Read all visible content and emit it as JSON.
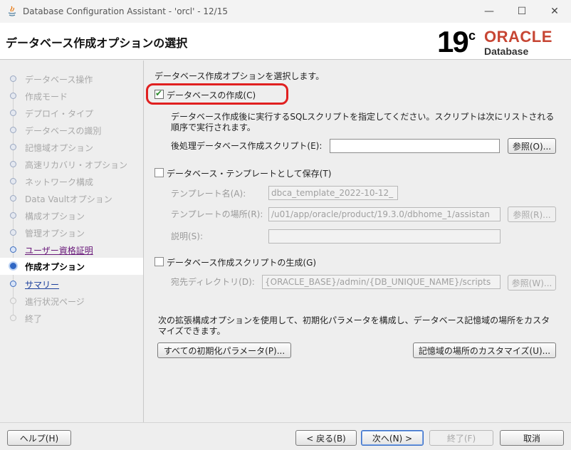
{
  "window": {
    "title": "Database Configuration Assistant - 'orcl' - 12/15",
    "minimize_glyph": "—",
    "maximize_glyph": "☐",
    "close_glyph": "✕"
  },
  "header": {
    "page_title": "データベース作成オプションの選択",
    "logo_version": "19",
    "logo_version_sup": "c",
    "logo_brand": "ORACLE",
    "logo_product": "Database",
    "logo_brand_color": "#c74634"
  },
  "steps": [
    {
      "label": "データベース操作",
      "state": "done"
    },
    {
      "label": "作成モード",
      "state": "done"
    },
    {
      "label": "デプロイ・タイプ",
      "state": "done"
    },
    {
      "label": "データベースの識別",
      "state": "done"
    },
    {
      "label": "記憶域オプション",
      "state": "done"
    },
    {
      "label": "高速リカバリ・オプション",
      "state": "done"
    },
    {
      "label": "ネットワーク構成",
      "state": "done"
    },
    {
      "label": "Data Vaultオプション",
      "state": "done"
    },
    {
      "label": "構成オプション",
      "state": "done"
    },
    {
      "label": "管理オプション",
      "state": "done"
    },
    {
      "label": "ユーザー資格証明",
      "state": "visited"
    },
    {
      "label": "作成オプション",
      "state": "current"
    },
    {
      "label": "サマリー",
      "state": "link"
    },
    {
      "label": "進行状況ページ",
      "state": "pending"
    },
    {
      "label": "終了",
      "state": "pending"
    }
  ],
  "main": {
    "intro": "データベース作成オプションを選択します。",
    "create_db": {
      "label": "データベースの作成(C)",
      "checked": true,
      "desc_line1": "データベース作成後に実行するSQLスクリプトを指定してください。スクリプトは次にリストされる",
      "desc_line2": "順序で実行されます。",
      "post_script_label": "後処理データベース作成スクリプト(E):",
      "post_script_value": "",
      "browse_label": "参照(O)..."
    },
    "save_template": {
      "label": "データベース・テンプレートとして保存(T)",
      "checked": false,
      "name_label": "テンプレート名(A):",
      "name_value": "dbca_template_2022-10-12_",
      "location_label": "テンプレートの場所(R):",
      "location_value": "/u01/app/oracle/product/19.3.0/dbhome_1/assistan",
      "location_browse": "参照(R)...",
      "desc_label": "説明(S):",
      "desc_value": ""
    },
    "gen_scripts": {
      "label": "データベース作成スクリプトの生成(G)",
      "checked": false,
      "dest_label": "宛先ディレクトリ(D):",
      "dest_value": "{ORACLE_BASE}/admin/{DB_UNIQUE_NAME}/scripts",
      "dest_browse": "参照(W)..."
    },
    "advanced_line1": "次の拡張構成オプションを使用して、初期化パラメータを構成し、データベース記憶域の場所をカスタ",
    "advanced_line2": "マイズできます。",
    "init_params_button": "すべての初期化パラメータ(P)...",
    "storage_locations_button": "記憶域の場所のカスタマイズ(U)..."
  },
  "footer": {
    "help": "ヘルプ(H)",
    "back": "< 戻る(B)",
    "next": "次へ(N) >",
    "finish": "終了(F)",
    "cancel": "取消"
  }
}
